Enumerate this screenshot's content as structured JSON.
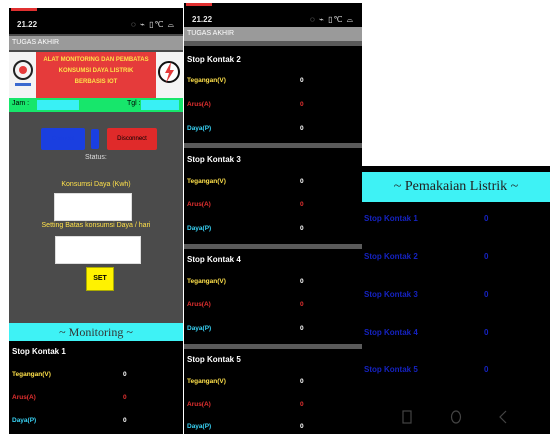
{
  "phone1": {
    "time": "21.22",
    "status_icons": "◌ ⌁ ▯℃ ⌓",
    "app_title": "TUGAS AKHIR",
    "header_title_lines": [
      "ALAT MONITORING DAN PEMBATAS",
      "KONSUMSI DAYA LISTRIK",
      "BERBASIS IOT"
    ],
    "jam_label": "Jam :",
    "tgl_label": "Tgl :",
    "connect_label": "Connect",
    "disconnect_label": "Disconnect",
    "status_label": "Status:",
    "konsumsi_label": "Konsumsi Daya (Kwh)",
    "setting_label": "Setting Batas konsumsi Daya / hari",
    "set_label": "SET",
    "monitoring_label": "~ Monitoring ~",
    "section_title": "Stop Kontak 1",
    "rows": [
      {
        "label": "Tegangan(V)",
        "value": "0"
      },
      {
        "label": "Arus(A)",
        "value": "0"
      },
      {
        "label": "Daya(P)",
        "value": "0"
      }
    ]
  },
  "phone2": {
    "time": "21.22",
    "status_icons": "◌ ⌁ ▯℃ ⌓",
    "app_title": "TUGAS AKHIR",
    "sections": [
      {
        "title": "Stop Kontak 2",
        "rows": [
          {
            "label": "Tegangan(V)",
            "value": "0"
          },
          {
            "label": "Arus(A)",
            "value": "0"
          },
          {
            "label": "Daya(P)",
            "value": "0"
          }
        ]
      },
      {
        "title": "Stop Kontak 3",
        "rows": [
          {
            "label": "Tegangan(V)",
            "value": "0"
          },
          {
            "label": "Arus(A)",
            "value": "0"
          },
          {
            "label": "Daya(P)",
            "value": "0"
          }
        ]
      },
      {
        "title": "Stop Kontak 4",
        "rows": [
          {
            "label": "Tegangan(V)",
            "value": "0"
          },
          {
            "label": "Arus(A)",
            "value": "0"
          },
          {
            "label": "Daya(P)",
            "value": "0"
          }
        ]
      },
      {
        "title": "Stop Kontak 5",
        "rows": [
          {
            "label": "Tegangan(V)",
            "value": "0"
          },
          {
            "label": "Arus(A)",
            "value": "0"
          },
          {
            "label": "Daya(P)",
            "value": "0"
          }
        ]
      }
    ]
  },
  "phone3": {
    "header": "~ Pemakaian Listrik ~",
    "rows": [
      {
        "label": "Stop Kontak 1",
        "value": "0"
      },
      {
        "label": "Stop Kontak 2",
        "value": "0"
      },
      {
        "label": "Stop Kontak 3",
        "value": "0"
      },
      {
        "label": "Stop Kontak 4",
        "value": "0"
      },
      {
        "label": "Stop Kontak 5",
        "value": "0"
      }
    ],
    "nav_icons": [
      "square-icon",
      "circle-icon",
      "back-triangle-icon"
    ]
  },
  "colors": {
    "header_red": "#e53b3b",
    "cyan_header": "#3ef2f5",
    "green_bar": "#17e66b",
    "connect_blue": "#1a3fe0",
    "set_yellow": "#fff200",
    "label_yellow": "#ffe14a",
    "label_red": "#e53030",
    "label_cyan": "#39d3f5",
    "dark_blue_text": "#1522c0"
  }
}
